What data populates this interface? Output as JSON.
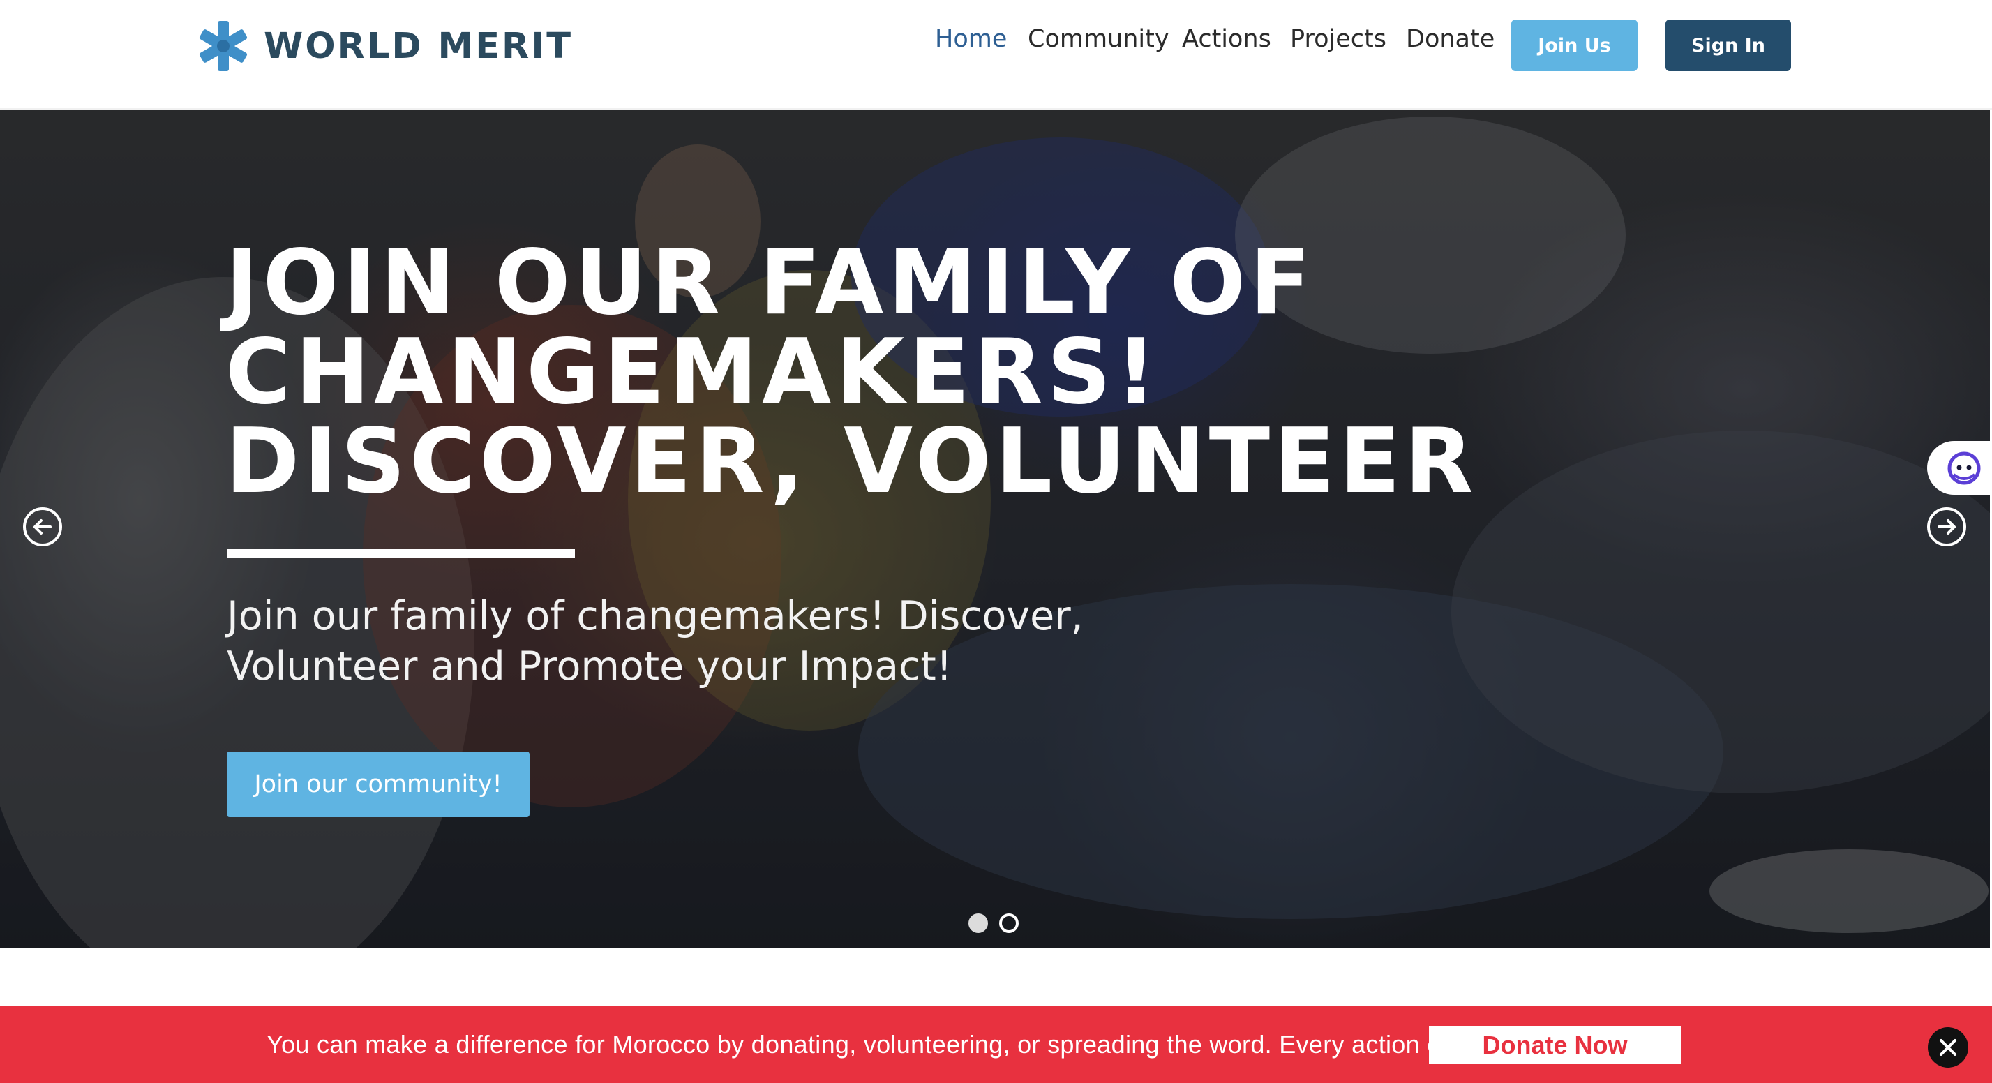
{
  "header": {
    "logo_text": "WORLD MERIT",
    "logo_icon": "asterisk-star-icon",
    "nav": [
      {
        "label": "Home",
        "active": true
      },
      {
        "label": "Community",
        "active": false
      },
      {
        "label": "Actions",
        "active": false
      },
      {
        "label": "Projects",
        "active": false
      },
      {
        "label": "Donate",
        "active": false
      }
    ],
    "join_label": "Join Us",
    "signin_label": "Sign In"
  },
  "hero": {
    "title": "JOIN OUR FAMILY OF CHANGEMAKERS! DISCOVER, VOLUNTEER",
    "subtitle": "Join our family of changemakers! Discover, Volunteer and Promote your Impact!",
    "cta_label": "Join our community!",
    "slides_total": 2,
    "active_slide": 1
  },
  "banner": {
    "text": "You can make a difference for Morocco by donating, volunteering, or spreading the word. Every action counts",
    "button_label": "Donate Now"
  },
  "colors": {
    "brand_dark": "#2b4a5e",
    "brand_light_blue": "#5fb4e2",
    "brand_navy": "#244d6c",
    "nav_active": "#2e5f93",
    "banner_red": "#e8313f"
  }
}
